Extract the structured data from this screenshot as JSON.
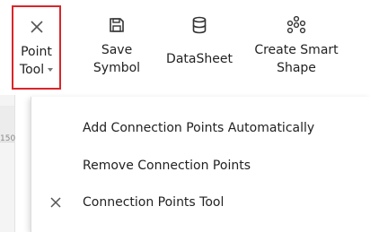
{
  "ribbon": {
    "point_tool": {
      "line1": "Point",
      "line2": "Tool",
      "icon": "point-tool-x-icon"
    },
    "save_symbol": {
      "line1": "Save",
      "line2": "Symbol",
      "icon": "save-icon"
    },
    "datasheet": {
      "label": "DataSheet",
      "icon": "database-icon"
    },
    "create_smart_shape": {
      "line1": "Create Smart",
      "line2": "Shape",
      "icon": "smart-shape-icon"
    }
  },
  "ruler": {
    "tick_label": "150"
  },
  "menu": {
    "items": [
      {
        "label": "Add Connection Points Automatically"
      },
      {
        "label": "Remove Connection Points"
      },
      {
        "label": "Connection Points Tool",
        "icon": "x-cross-icon"
      }
    ]
  },
  "colors": {
    "selection_border": "#d9262b",
    "icon_dark": "#333333"
  }
}
